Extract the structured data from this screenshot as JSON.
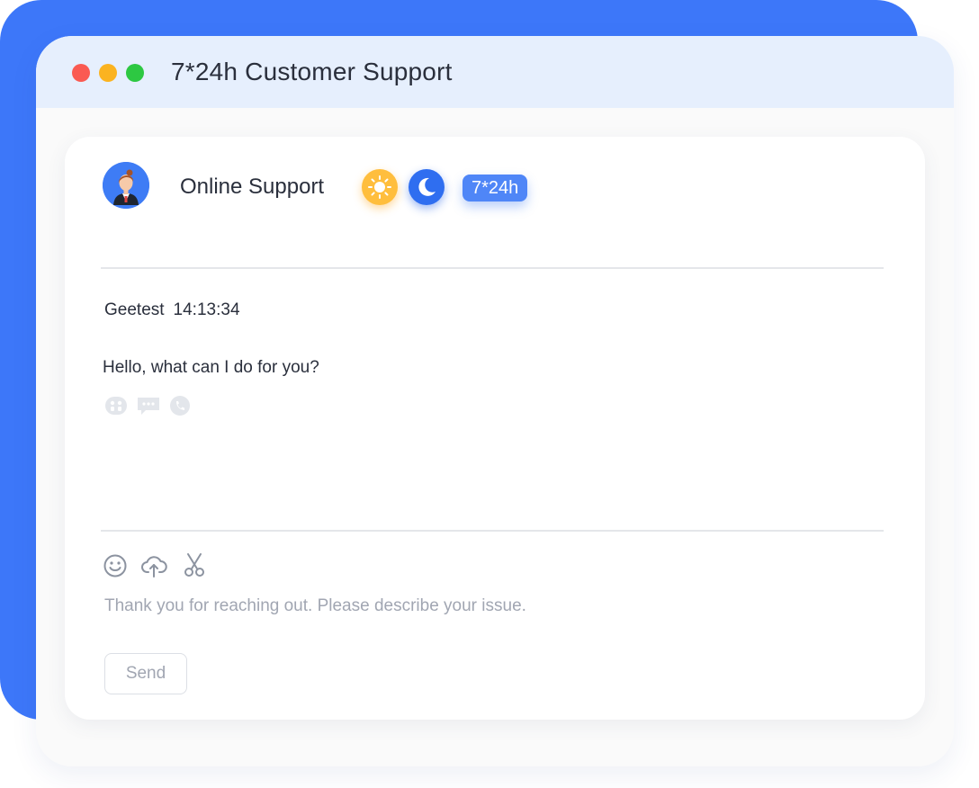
{
  "window": {
    "title": "7*24h Customer Support"
  },
  "agent": {
    "name": "Online Support",
    "avatar_icon": "agent-avatar",
    "badge": "7*24h",
    "theme_toggles": [
      "sun-icon",
      "moon-icon"
    ]
  },
  "message": {
    "sender": "Geetest",
    "time": "14:13:34",
    "text": "Hello, what can I do for you?",
    "action_icons": [
      "group-icon",
      "chat-icon",
      "phone-icon"
    ]
  },
  "composer": {
    "tool_icons": [
      "emoji-icon",
      "upload-cloud-icon",
      "scissors-icon"
    ],
    "placeholder": "Thank you for reaching out. Please describe your issue.",
    "value": "",
    "send_label": "Send"
  },
  "colors": {
    "accent": "#3d77f9",
    "badge": "#4f86f7",
    "sun": "#ffbe3d",
    "moon": "#2f6ef0",
    "dot_red": "#fa5a52",
    "dot_yellow": "#fbb320",
    "dot_green": "#2dc842"
  }
}
